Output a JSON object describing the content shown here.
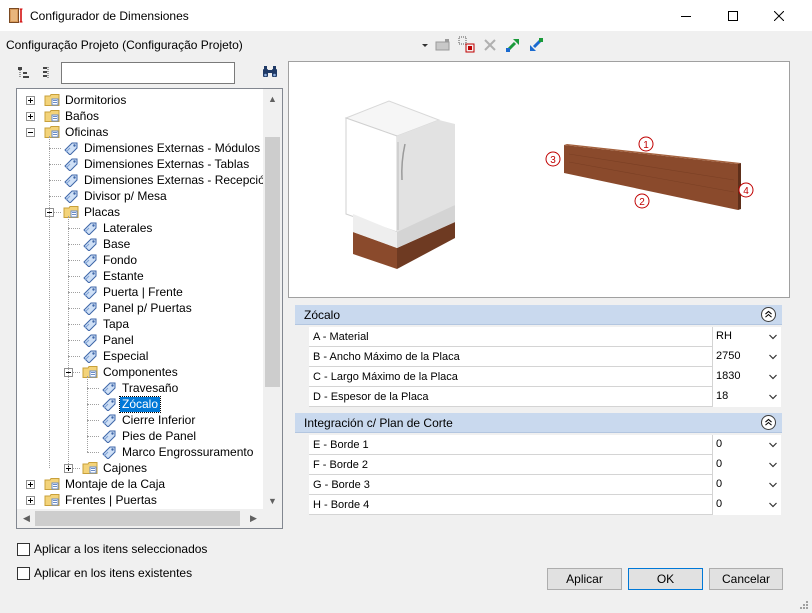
{
  "window": {
    "title": "Configurador de Dimensiones",
    "minimize_icon": "minimize-icon",
    "maximize_icon": "maximize-icon",
    "close_icon": "close-icon"
  },
  "toolbar": {
    "configuration": "Configuração Projeto (Configuração Projeto)"
  },
  "search": {
    "value": "",
    "placeholder": ""
  },
  "tree": [
    {
      "label": "Dormitorios",
      "depth": 0,
      "icon": "folder-icon",
      "expander": "plus"
    },
    {
      "label": "Baños",
      "depth": 0,
      "icon": "folder-icon",
      "expander": "plus"
    },
    {
      "label": "Oficinas",
      "depth": 0,
      "icon": "folder-icon",
      "expander": "minus"
    },
    {
      "label": "Dimensiones Externas - Módulos",
      "depth": 1,
      "icon": "tag-icon"
    },
    {
      "label": "Dimensiones Externas - Tablas",
      "depth": 1,
      "icon": "tag-icon"
    },
    {
      "label": "Dimensiones Externas - Recepción",
      "depth": 1,
      "icon": "tag-icon"
    },
    {
      "label": "Divisor p/ Mesa",
      "depth": 1,
      "icon": "tag-icon"
    },
    {
      "label": "Placas",
      "depth": 1,
      "icon": "folder-icon",
      "expander": "minus"
    },
    {
      "label": "Laterales",
      "depth": 2,
      "icon": "tag-icon"
    },
    {
      "label": "Base",
      "depth": 2,
      "icon": "tag-icon"
    },
    {
      "label": "Fondo",
      "depth": 2,
      "icon": "tag-icon"
    },
    {
      "label": "Estante",
      "depth": 2,
      "icon": "tag-icon"
    },
    {
      "label": "Puerta | Frente",
      "depth": 2,
      "icon": "tag-icon"
    },
    {
      "label": "Panel p/ Puertas",
      "depth": 2,
      "icon": "tag-icon"
    },
    {
      "label": "Tapa",
      "depth": 2,
      "icon": "tag-icon"
    },
    {
      "label": "Panel",
      "depth": 2,
      "icon": "tag-icon"
    },
    {
      "label": "Especial",
      "depth": 2,
      "icon": "tag-icon"
    },
    {
      "label": "Componentes",
      "depth": 2,
      "icon": "folder-icon",
      "expander": "minus"
    },
    {
      "label": "Travesaño",
      "depth": 3,
      "icon": "tag-icon"
    },
    {
      "label": "Zócalo",
      "depth": 3,
      "icon": "tag-icon",
      "selected": true
    },
    {
      "label": "Cierre Inferior",
      "depth": 3,
      "icon": "tag-icon"
    },
    {
      "label": "Pies de Panel",
      "depth": 3,
      "icon": "tag-icon"
    },
    {
      "label": "Marco Engrossuramento",
      "depth": 3,
      "icon": "tag-icon"
    },
    {
      "label": "Cajones",
      "depth": 2,
      "icon": "folder-icon",
      "expander": "plus"
    },
    {
      "label": "Montaje de la Caja",
      "depth": 0,
      "icon": "folder-icon",
      "expander": "plus"
    },
    {
      "label": "Frentes | Puertas",
      "depth": 0,
      "icon": "folder-icon",
      "expander": "plus"
    }
  ],
  "preview": {
    "callouts": [
      "1",
      "2",
      "3",
      "4"
    ]
  },
  "sections": [
    {
      "title": "Zócalo",
      "rows": [
        {
          "name": "A - Material",
          "value": "RH"
        },
        {
          "name": "B -  Ancho Máximo de la Placa",
          "value": "2750"
        },
        {
          "name": "C - Largo Máximo de la Placa",
          "value": "1830"
        },
        {
          "name": "D - Espesor de la Placa",
          "value": "18"
        }
      ]
    },
    {
      "title": "Integración c/ Plan de Corte",
      "rows": [
        {
          "name": "E - Borde 1",
          "value": "0"
        },
        {
          "name": "F - Borde 2",
          "value": "0"
        },
        {
          "name": "G - Borde 3",
          "value": "0"
        },
        {
          "name": "H - Borde 4",
          "value": "0"
        }
      ]
    }
  ],
  "options": {
    "apply_selected": "Aplicar a los itens seleccionados",
    "apply_existing": "Aplicar en los itens existentes"
  },
  "buttons": {
    "apply": "Aplicar",
    "ok": "OK",
    "cancel": "Cancelar"
  },
  "colors": {
    "section_header": "#c9d9ee",
    "selection": "#0078d7",
    "wood": "#8a4a2c"
  }
}
